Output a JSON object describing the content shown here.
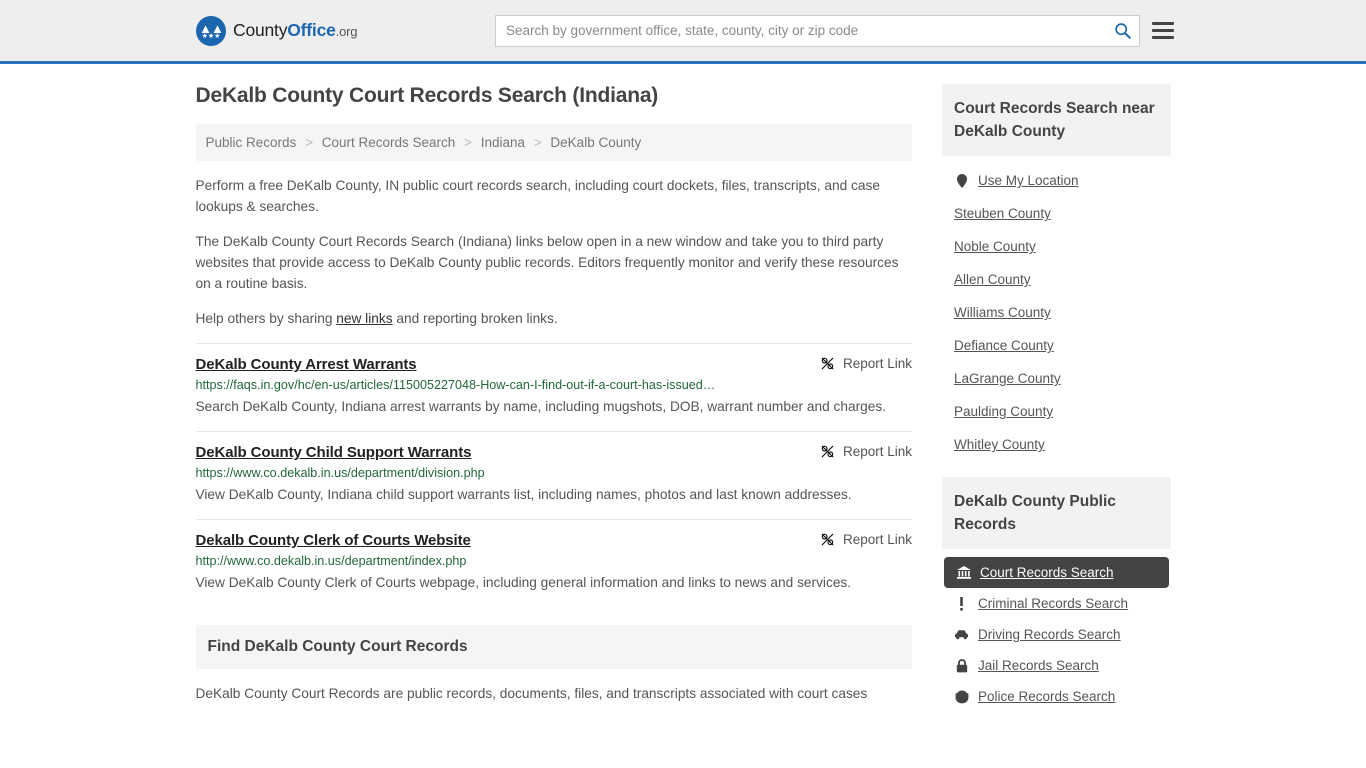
{
  "header": {
    "logo": {
      "name_part1": "County",
      "name_part2": "Office",
      "name_part3": ".org"
    },
    "search": {
      "placeholder": "Search by government office, state, county, city or zip code",
      "value": "",
      "button_icon": "search-icon"
    },
    "menu_icon": "hamburger-menu-icon",
    "accent_color": "#2a72b5",
    "background_color": "#eeeeee"
  },
  "page_title": "DeKalb County Court Records Search (Indiana)",
  "breadcrumb": {
    "separator": ">",
    "items": [
      {
        "label": "Public Records"
      },
      {
        "label": "Court Records Search"
      },
      {
        "label": "Indiana"
      },
      {
        "label": "DeKalb County"
      }
    ]
  },
  "intro": {
    "p1": "Perform a free DeKalb County, IN public court records search, including court dockets, files, transcripts, and case lookups & searches.",
    "p2": "The DeKalb County Court Records Search (Indiana) links below open in a new window and take you to third party websites that provide access to DeKalb County public records. Editors frequently monitor and verify these resources on a routine basis.",
    "p3_before": "Help others by sharing ",
    "p3_link": "new links",
    "p3_after": " and reporting broken links."
  },
  "report_link_label": "Report Link",
  "report_link_icon": "broken-link-icon",
  "results": [
    {
      "title": "DeKalb County Arrest Warrants",
      "url": "https://faqs.in.gov/hc/en-us/articles/115005227048-How-can-I-find-out-if-a-court-has-issued…",
      "description": "Search DeKalb County, Indiana arrest warrants by name, including mugshots, DOB, warrant number and charges."
    },
    {
      "title": "DeKalb County Child Support Warrants",
      "url": "https://www.co.dekalb.in.us/department/division.php",
      "description": "View DeKalb County, Indiana child support warrants list, including names, photos and last known addresses."
    },
    {
      "title": "Dekalb County Clerk of Courts Website",
      "url": "http://www.co.dekalb.in.us/department/index.php",
      "description": "View DeKalb County Clerk of Courts webpage, including general information and links to news and services."
    }
  ],
  "find_section": {
    "heading": "Find DeKalb County Court Records",
    "body": "DeKalb County Court Records are public records, documents, files, and transcripts associated with court cases"
  },
  "sidebar": {
    "nearby_panel": {
      "title": "Court Records Search near DeKalb County",
      "items": [
        {
          "label": "Use My Location",
          "icon": "map-pin-icon"
        },
        {
          "label": "Steuben County",
          "icon": ""
        },
        {
          "label": "Noble County",
          "icon": ""
        },
        {
          "label": "Allen County",
          "icon": ""
        },
        {
          "label": "Williams County",
          "icon": ""
        },
        {
          "label": "Defiance County",
          "icon": ""
        },
        {
          "label": "LaGrange County",
          "icon": ""
        },
        {
          "label": "Paulding County",
          "icon": ""
        },
        {
          "label": "Whitley County",
          "icon": ""
        }
      ]
    },
    "records_panel": {
      "title": "DeKalb County Public Records",
      "items": [
        {
          "label": "Court Records Search",
          "icon": "courthouse-icon",
          "active": true
        },
        {
          "label": "Criminal Records Search",
          "icon": "exclamation-icon",
          "active": false
        },
        {
          "label": "Driving Records Search",
          "icon": "car-icon",
          "active": false
        },
        {
          "label": "Jail Records Search",
          "icon": "lock-icon",
          "active": false
        },
        {
          "label": "Police Records Search",
          "icon": "police-badge-icon",
          "active": false
        }
      ],
      "active_background_color": "#444444"
    }
  }
}
